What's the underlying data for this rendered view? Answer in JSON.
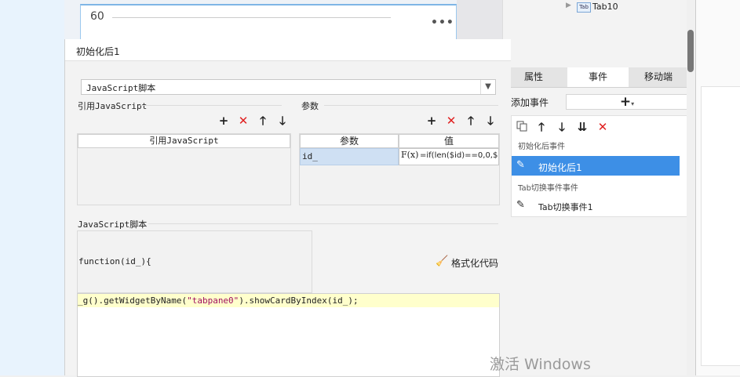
{
  "background": {
    "card_value": "60",
    "more_icon": "more-dots-icon"
  },
  "tree": {
    "node_label": "Tab10"
  },
  "right_tabs": [
    "属性",
    "事件",
    "移动端"
  ],
  "events_panel": {
    "add_label": "添加事件",
    "group1_header": "初始化后事件",
    "group1_item": "初始化后1",
    "group2_header": "Tab切换事件事件",
    "group2_item": "Tab切换事件1"
  },
  "dialog": {
    "title": "初始化后1",
    "type_select": "JavaScript脚本",
    "ref_section_label": "引用JavaScript",
    "ref_column_header": "引用JavaScript",
    "param_section_label": "参数",
    "param_headers": [
      "参数",
      "值"
    ],
    "param_name": "id_",
    "param_fx": "F(x)",
    "param_value": "=if(len($id)==0,0,$",
    "script_section_label": "JavaScript脚本",
    "function_signature": "function(id_){",
    "format_code_label": "格式化代码",
    "code_prefix": "_g().getWidgetByName(",
    "code_string": "\"tabpane0\"",
    "code_suffix": ").showCardByIndex(id_);"
  },
  "watermark": "激活 Windows",
  "colors": {
    "selection_blue": "#3d8fe6",
    "delete_red": "#e02020",
    "code_highlight": "#ffffcc",
    "string_color": "#a01060"
  }
}
